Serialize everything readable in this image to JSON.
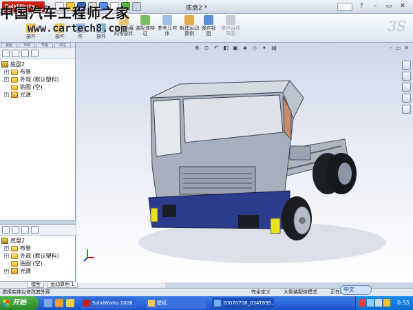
{
  "watermark": {
    "cn": "中国汽车工程师之家",
    "url": "www.cartech8.com"
  },
  "titlebar": {
    "app": "SolidWorks",
    "document_title": "底盘2 *"
  },
  "ribbon": {
    "items": [
      {
        "label": "部件",
        "disabled": false
      },
      {
        "label": "部件",
        "disabled": false
      },
      {
        "label": "件",
        "disabled": false
      },
      {
        "label": "部件",
        "disabled": false
      },
      {
        "label": "显示隐藏的零部件",
        "disabled": false
      },
      {
        "label": "装配体特征",
        "disabled": false
      },
      {
        "label": "参考几何体",
        "disabled": false
      },
      {
        "label": "新建运动算例",
        "disabled": false
      },
      {
        "label": "爆炸视图",
        "disabled": false
      },
      {
        "label": "爆炸直线草图",
        "disabled": true
      }
    ]
  },
  "left_panel": {
    "tabs": [
      "装配",
      "布局",
      "草图",
      "评估"
    ],
    "tree_top": {
      "root": "底盘2",
      "nodes": [
        "布景",
        "外观 (默认塑料)",
        "贴图 (空)",
        "光源"
      ]
    },
    "tree_bottom": {
      "root": "底盘2",
      "nodes": [
        "布景",
        "外观 (默认塑料)",
        "贴图 (空)",
        "光源"
      ]
    },
    "bottom_tabs": [
      "模型",
      "运动算例 1"
    ]
  },
  "status": {
    "hint": "选择实体以修改其外观",
    "state": "完全定义",
    "mode": "大型装配体模式",
    "editing": "正在编辑：装配体"
  },
  "ime": {
    "label": "中文"
  },
  "taskbar": {
    "start_label": "开始",
    "tasks": [
      {
        "label": "SolidWorks 2008 ..."
      },
      {
        "label": "壁纸"
      },
      {
        "label": "20070708_034T895..."
      }
    ],
    "clock": "0:55"
  }
}
